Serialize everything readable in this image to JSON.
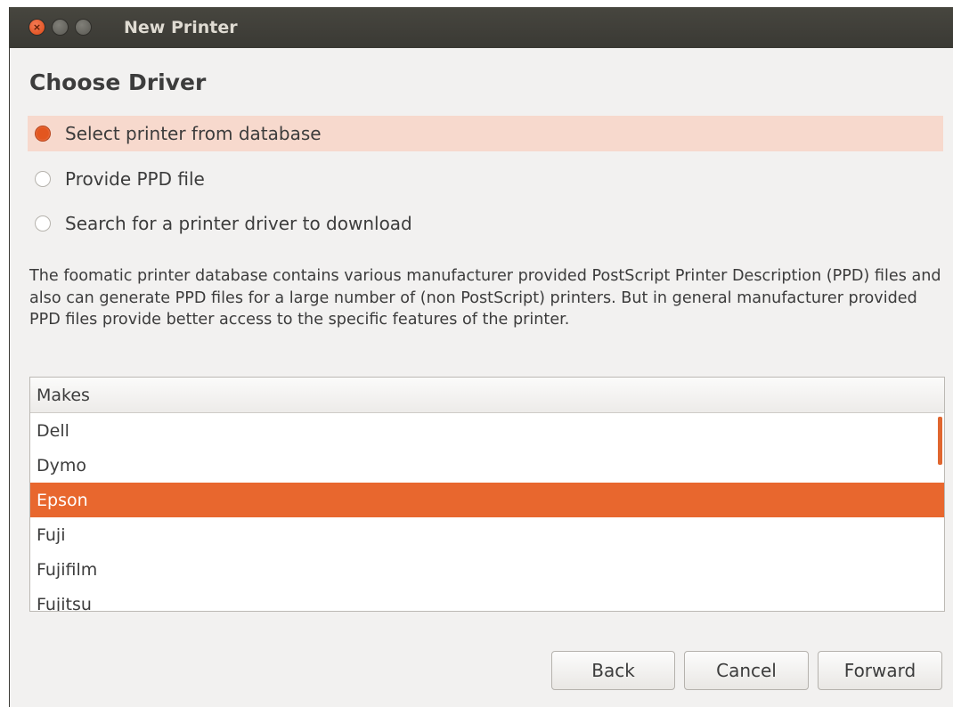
{
  "window": {
    "title": "New Printer"
  },
  "page": {
    "heading": "Choose Driver"
  },
  "options": [
    {
      "label": "Select printer from database",
      "selected": true
    },
    {
      "label": "Provide PPD file",
      "selected": false
    },
    {
      "label": "Search for a printer driver to download",
      "selected": false
    }
  ],
  "description": "The foomatic printer database contains various manufacturer provided PostScript Printer Description (PPD) files and also can generate PPD files for a large number of (non PostScript) printers. But in general manufacturer provided PPD files provide better access to the specific features of the printer.",
  "makes": {
    "header": "Makes",
    "items": [
      "Dell",
      "Dymo",
      "Epson",
      "Fuji",
      "Fujifilm",
      "Fujitsu"
    ],
    "selected": "Epson"
  },
  "buttons": {
    "back": "Back",
    "cancel": "Cancel",
    "forward": "Forward"
  },
  "colors": {
    "accent": "#e8672e",
    "selected_row_bg": "#f7d9cd",
    "titlebar": "#3c3b37"
  }
}
